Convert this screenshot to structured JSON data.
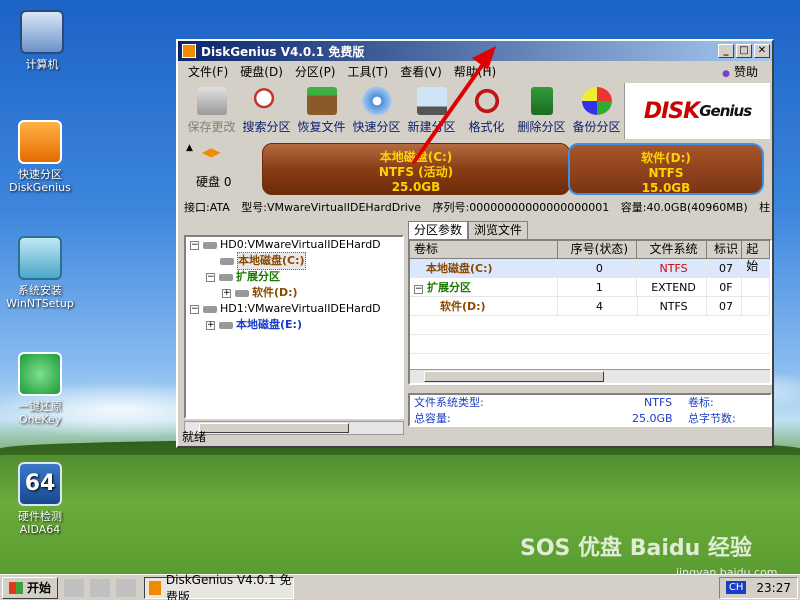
{
  "desktop": {
    "icons": [
      {
        "label": "计算机"
      },
      {
        "label": "快速分区\nDiskGenius"
      },
      {
        "label": "系统安装\nWinNTSetup"
      },
      {
        "label": "一键还原\nOneKey"
      },
      {
        "label": "硬件检测\nAIDA64",
        "badge": "64"
      }
    ]
  },
  "window": {
    "title": "DiskGenius V4.0.1 免费版",
    "menu": [
      "文件(F)",
      "硬盘(D)",
      "分区(P)",
      "工具(T)",
      "查看(V)",
      "帮助(H)"
    ],
    "sponsor": "赞助",
    "toolbar": [
      {
        "label": "保存更改",
        "disabled": true,
        "icon": "save-icon"
      },
      {
        "label": "搜索分区",
        "icon": "magnifier-icon"
      },
      {
        "label": "恢复文件",
        "icon": "recover-icon"
      },
      {
        "label": "快速分区",
        "icon": "disk-icon"
      },
      {
        "label": "新建分区",
        "icon": "new-partition-icon"
      },
      {
        "label": "格式化",
        "icon": "format-icon"
      },
      {
        "label": "删除分区",
        "icon": "trash-icon"
      },
      {
        "label": "备份分区",
        "icon": "backup-icon"
      }
    ],
    "logo": {
      "main": "DISK",
      "sub": "Genius"
    },
    "disk_label": "硬盘 0",
    "partitions_bar": [
      {
        "name": "本地磁盘(C:)",
        "fs": "NTFS (活动)",
        "size": "25.0GB"
      },
      {
        "name": "软件(D:)",
        "fs": "NTFS",
        "size": "15.0GB"
      }
    ],
    "infobar": {
      "iface": "接口:ATA",
      "model": "型号:VMwareVirtualIDEHardDrive",
      "serial": "序列号:00000000000000000001",
      "capacity": "容量:40.0GB(40960MB)",
      "tail": "柱"
    },
    "tree": [
      {
        "text": "HD0:VMwareVirtualIDEHardD",
        "level": 0,
        "exp": "−"
      },
      {
        "text": "本地磁盘(C:)",
        "level": 1,
        "style": "brown"
      },
      {
        "text": "扩展分区",
        "level": 1,
        "style": "green",
        "exp": "−"
      },
      {
        "text": "软件(D:)",
        "level": 2,
        "style": "brown",
        "exp": "+"
      },
      {
        "text": "HD1:VMwareVirtualIDEHardD",
        "level": 0,
        "exp": "−"
      },
      {
        "text": "本地磁盘(E:)",
        "level": 1,
        "style": "blue",
        "exp": "+"
      }
    ],
    "tabs": [
      "分区参数",
      "浏览文件"
    ],
    "table": {
      "headers": [
        "卷标",
        "序号(状态)",
        "文件系统",
        "标识",
        "起始"
      ],
      "rows": [
        {
          "name": "本地磁盘(C:)",
          "seq": "0",
          "fs": "NTFS",
          "id": "07",
          "style": "brown",
          "selected": true
        },
        {
          "name": "扩展分区",
          "seq": "1",
          "fs": "EXTEND",
          "id": "0F",
          "style": "green"
        },
        {
          "name": "软件(D:)",
          "seq": "4",
          "fs": "NTFS",
          "id": "07",
          "style": "brown"
        }
      ]
    },
    "summary": {
      "fs_type_label": "文件系统类型:",
      "fs_type_value": "NTFS",
      "volume_label": "卷标:",
      "total_label": "总容量:",
      "total_value": "25.0GB",
      "total_bytes_label": "总字节数:"
    },
    "status": "就绪"
  },
  "taskbar": {
    "start": "开始",
    "task": "DiskGenius V4.0.1 免费版",
    "ime": "CH",
    "clock": "23:27"
  },
  "watermark": {
    "text": "SOS 优盘 Baidu 经验",
    "url": "jingyan.baidu.com"
  }
}
